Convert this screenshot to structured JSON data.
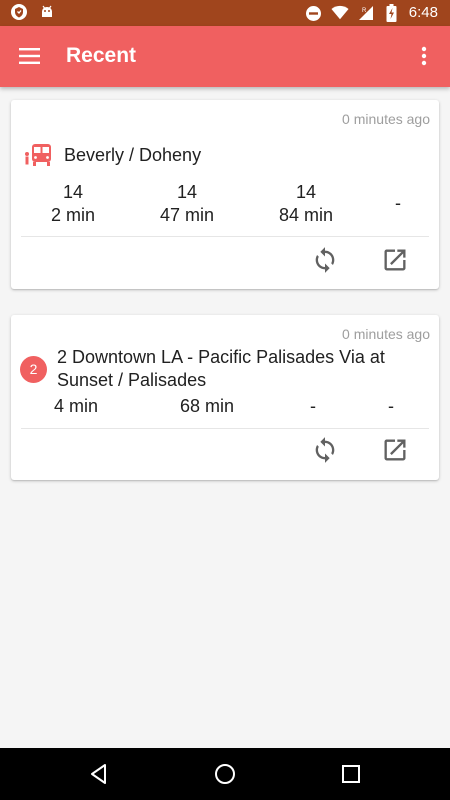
{
  "status_bar": {
    "time": "6:48",
    "left_icons": [
      "shield-notification-icon",
      "android-notification-icon"
    ],
    "right_icons": [
      "do-not-disturb-icon",
      "wifi-icon",
      "signal-icon",
      "battery-charging-icon"
    ]
  },
  "app_bar": {
    "title": "Recent",
    "menu_icon": "menu-icon",
    "overflow_icon": "more-vert-icon"
  },
  "colors": {
    "accent": "#f06060",
    "status_bar": "#a0451d",
    "secondary_text": "#9e9e9e",
    "icon_gray": "#616161"
  },
  "cards": [
    {
      "time_ago": "0 minutes ago",
      "icon": "bus-stop-icon",
      "title": "Beverly / Doheny",
      "arrivals": [
        {
          "route": "14",
          "time": "2 min"
        },
        {
          "route": "14",
          "time": "47 min"
        },
        {
          "route": "14",
          "time": "84 min"
        },
        {
          "route": "",
          "time": "-"
        }
      ],
      "actions": [
        "refresh-icon",
        "open-external-icon"
      ]
    },
    {
      "time_ago": "0 minutes ago",
      "route_badge": "2",
      "title": "2 Downtown LA - Pacific Palisades Via at Sunset / Palisades",
      "arrivals": [
        "4 min",
        "68 min",
        "-",
        "-"
      ],
      "actions": [
        "refresh-icon",
        "open-external-icon"
      ]
    }
  ],
  "nav_bar": {
    "icons": [
      "back-icon",
      "home-icon",
      "recents-icon"
    ]
  }
}
